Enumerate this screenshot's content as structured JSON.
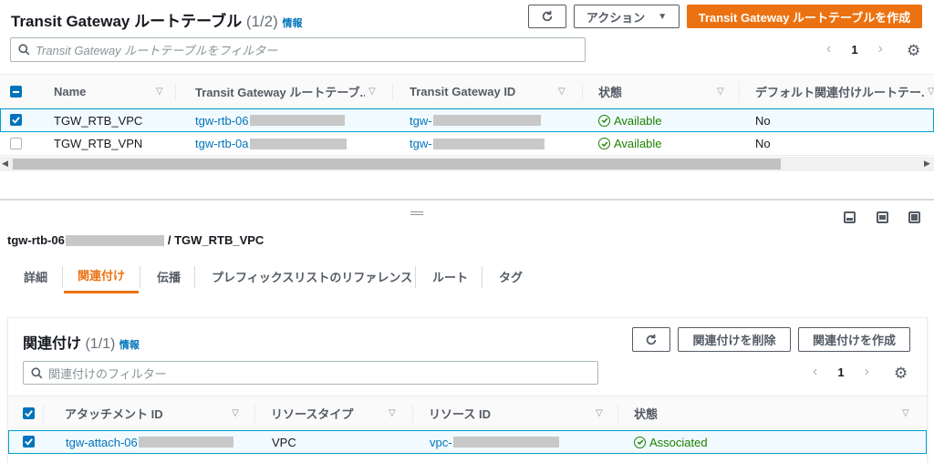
{
  "top": {
    "title": "Transit Gateway ルートテーブル",
    "count": "(1/2)",
    "info": "情報",
    "actions_label": "アクション",
    "create_label": "Transit Gateway ルートテーブルを作成",
    "filter_placeholder": "Transit Gateway ルートテーブルをフィルター",
    "page": "1",
    "columns": [
      "Name",
      "Transit Gateway ルートテーブ...",
      "Transit Gateway ID",
      "状態",
      "デフォルト関連付けルートテー..."
    ],
    "rows": [
      {
        "name": "TGW_RTB_VPC",
        "rtb_id": "tgw-rtb-06",
        "tgw_id": "tgw-",
        "state": "Available",
        "default_assoc": "No",
        "selected": true
      },
      {
        "name": "TGW_RTB_VPN",
        "rtb_id": "tgw-rtb-0a",
        "tgw_id": "tgw-",
        "state": "Available",
        "default_assoc": "No",
        "selected": false
      }
    ]
  },
  "detail": {
    "id_prefix": "tgw-rtb-06",
    "name_suffix": "/ TGW_RTB_VPC",
    "tabs": [
      "詳細",
      "関連付け",
      "伝播",
      "プレフィックスリストのリファレンス",
      "ルート",
      "タグ"
    ],
    "active_tab": "関連付け"
  },
  "assoc": {
    "title": "関連付け",
    "count": "(1/1)",
    "info": "情報",
    "delete_label": "関連付けを削除",
    "create_label": "関連付けを作成",
    "filter_placeholder": "関連付けのフィルター",
    "page": "1",
    "columns": [
      "アタッチメント ID",
      "リソースタイプ",
      "リソース ID",
      "状態"
    ],
    "rows": [
      {
        "attachment_id": "tgw-attach-06",
        "resource_type": "VPC",
        "resource_id": "vpc-",
        "state": "Associated",
        "selected": true
      }
    ]
  }
}
